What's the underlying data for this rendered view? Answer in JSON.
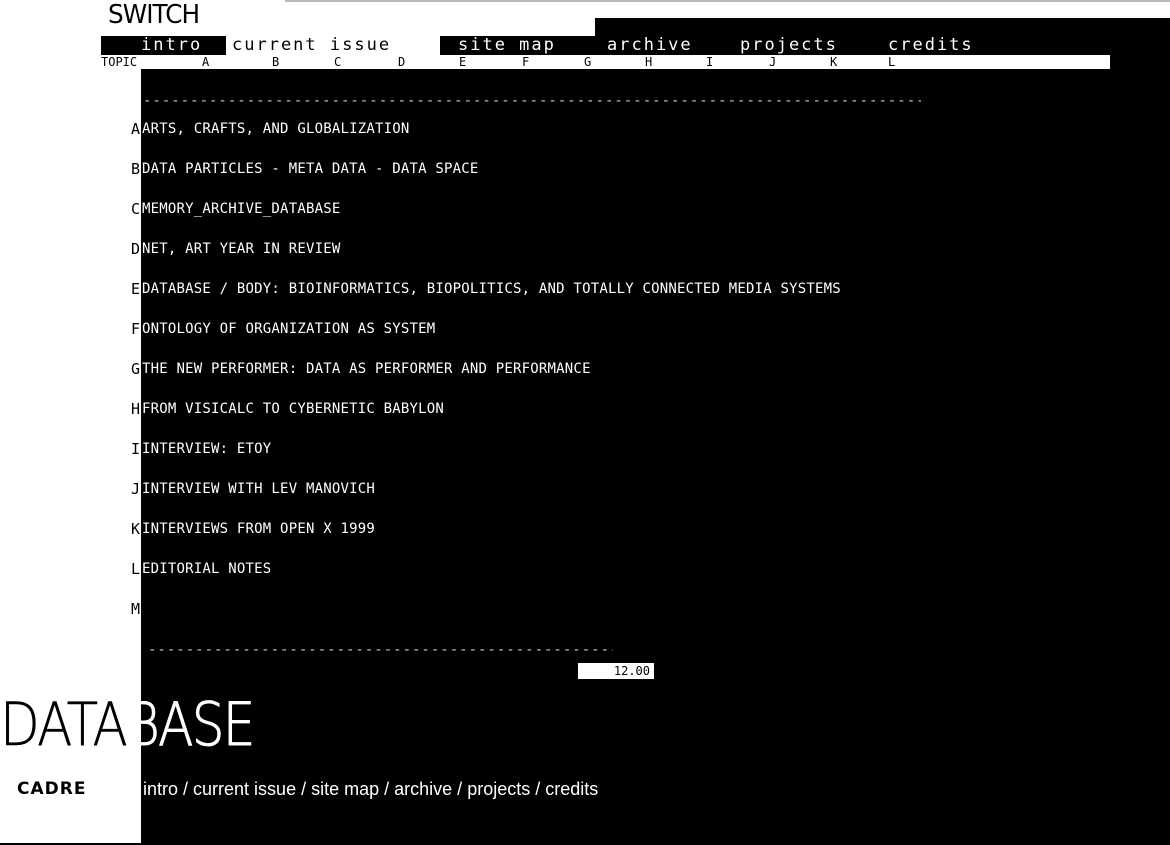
{
  "header": {
    "logo": "SWITCH",
    "nav": [
      {
        "label": "intro",
        "selected": false
      },
      {
        "label": "current issue",
        "selected": true
      },
      {
        "label": "site map",
        "selected": false
      },
      {
        "label": "archive",
        "selected": false
      },
      {
        "label": "projects",
        "selected": false
      },
      {
        "label": "credits",
        "selected": false
      }
    ],
    "topic_label": "TOPIC",
    "topic_letters": [
      "A",
      "B",
      "C",
      "D",
      "E",
      "F",
      "G",
      "H",
      "I",
      "J",
      "K",
      "L"
    ]
  },
  "topics": [
    {
      "letter": "A",
      "title": "ARTS, CRAFTS, AND GLOBALIZATION"
    },
    {
      "letter": "B",
      "title": "DATA PARTICLES - META DATA - DATA SPACE"
    },
    {
      "letter": "C",
      "title": "MEMORY_ARCHIVE_DATABASE"
    },
    {
      "letter": "D",
      "title": "NET, ART YEAR IN REVIEW"
    },
    {
      "letter": "E",
      "title": "DATABASE / BODY: BIOINFORMATICS, BIOPOLITICS, AND TOTALLY CONNECTED MEDIA SYSTEMS"
    },
    {
      "letter": "F",
      "title": "ONTOLOGY OF ORGANIZATION AS SYSTEM"
    },
    {
      "letter": "G",
      "title": "THE  NEW PERFORMER: DATA AS PERFORMER AND PERFORMANCE"
    },
    {
      "letter": "H",
      "title": "FROM VISICALC TO CYBERNETIC BABYLON"
    },
    {
      "letter": "I",
      "title": "INTERVIEW: ETOY"
    },
    {
      "letter": "J",
      "title": "INTERVIEW WITH LEV MANOVICH"
    },
    {
      "letter": "K",
      "title": "INTERVIEWS FROM OPEN X 1999"
    },
    {
      "letter": "L",
      "title": "EDITORIAL NOTES"
    },
    {
      "letter": "M",
      "title": ""
    }
  ],
  "counter": "12.00",
  "footer": {
    "title": "DATABASE",
    "title_dark_part": "DATA",
    "title_light_part": "BASE",
    "cadre": "CADRE",
    "links": [
      "intro",
      "current issue",
      "site map",
      "archive",
      "projects",
      "credits"
    ],
    "separator": " / "
  }
}
